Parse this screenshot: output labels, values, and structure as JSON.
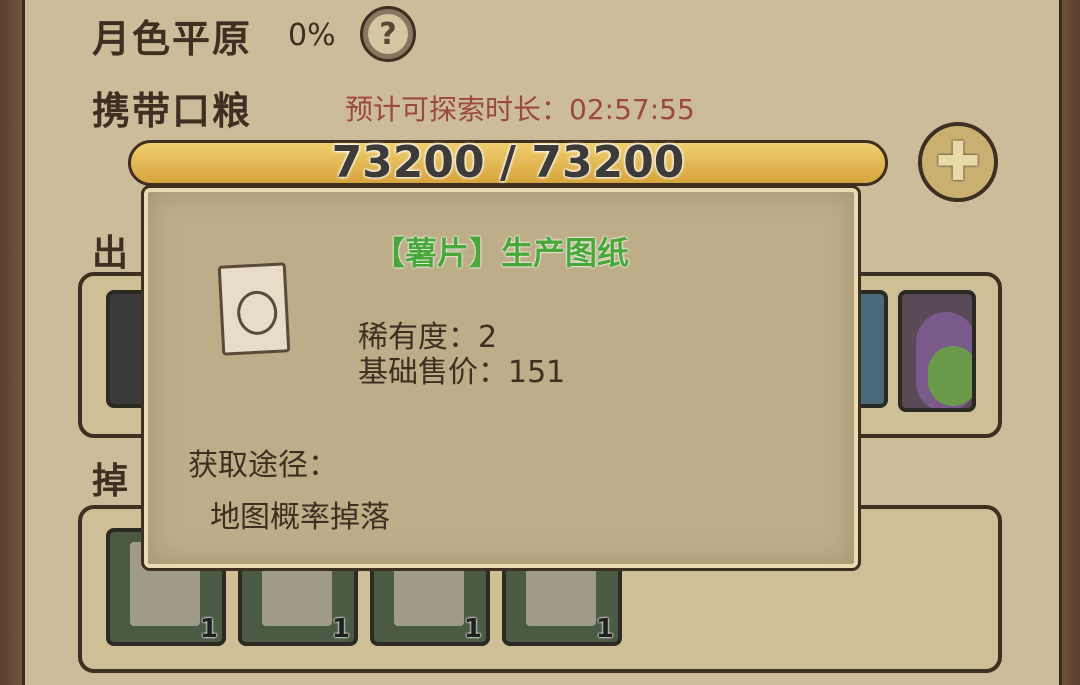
{
  "region": {
    "name": "月色平原",
    "progress": "0%"
  },
  "food": {
    "label": "携带口粮",
    "estimate": "预计可探索时长：02:57:55",
    "current": 73200,
    "max": 73200,
    "display": "73200 / 73200",
    "fill_fraction": 1.0
  },
  "sections": {
    "party_label": "出",
    "drops_label": "掉"
  },
  "drops": [
    {
      "icon": "potato-chip-blueprint-icon",
      "count": "1"
    },
    {
      "icon": "blueprint-icon",
      "count": "1"
    },
    {
      "icon": "blueprint-icon",
      "count": "1"
    },
    {
      "icon": "blueprint-icon",
      "count": "1"
    }
  ],
  "tooltip": {
    "title": "【薯片】生产图纸",
    "rarity": "稀有度：2",
    "base_price": "基础售价：151",
    "source_label": "获取途径：",
    "source": "地图概率掉落",
    "icon": "blueprint-paper-icon"
  },
  "colors": {
    "panel": "#cdbc99",
    "tooltip_title": "#4aa83a",
    "estimate_text": "#9a4a3e",
    "bar": "#e8c15c"
  }
}
